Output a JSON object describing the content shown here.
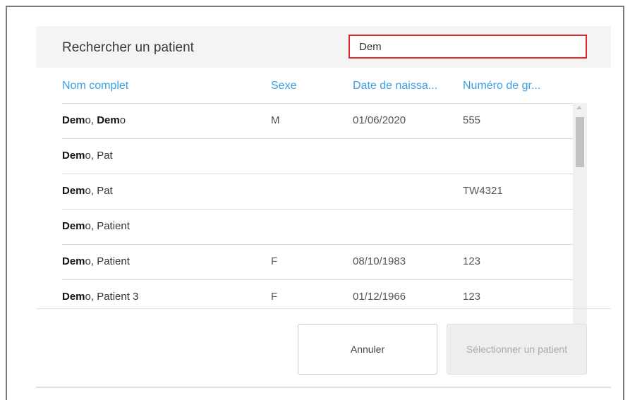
{
  "dialog": {
    "title": "Rechercher un patient",
    "search_value": "Dem",
    "columns": [
      "Nom complet",
      "Sexe",
      "Date de naissa...",
      "Numéro de gr..."
    ],
    "rows": [
      {
        "match": "Dem",
        "name_a": "o, ",
        "match2": "Dem",
        "name_b": "o",
        "sexe": "M",
        "date": "01/06/2020",
        "num": "555"
      },
      {
        "match": "Dem",
        "name_a": "o, Pat",
        "match2": "",
        "name_b": "",
        "sexe": "",
        "date": "",
        "num": ""
      },
      {
        "match": "Dem",
        "name_a": "o, Pat",
        "match2": "",
        "name_b": "",
        "sexe": "",
        "date": "",
        "num": "TW4321"
      },
      {
        "match": "Dem",
        "name_a": "o, Patient",
        "match2": "",
        "name_b": "",
        "sexe": "",
        "date": "",
        "num": ""
      },
      {
        "match": "Dem",
        "name_a": "o, Patient",
        "match2": "",
        "name_b": "",
        "sexe": "F",
        "date": "08/10/1983",
        "num": "123"
      },
      {
        "match": "Dem",
        "name_a": "o, Patient 3",
        "match2": "",
        "name_b": "",
        "sexe": "F",
        "date": "01/12/1966",
        "num": "123"
      }
    ],
    "cancel_label": "Annuler",
    "select_label": "Sélectionner un patient"
  },
  "colors": {
    "accent": "#3aa0e6",
    "search_border": "#e3262f"
  },
  "icons": [
    "scroll-up-arrow-icon",
    "scroll-down-arrow-icon"
  ]
}
